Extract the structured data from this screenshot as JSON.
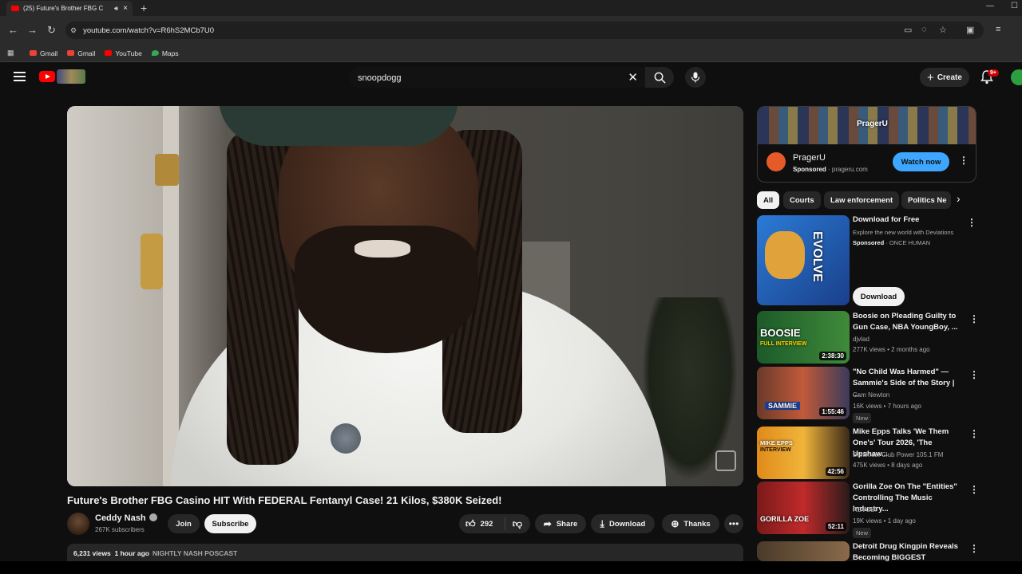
{
  "browser": {
    "tab_title": "(25) Future's Brother FBG C",
    "url": "youtube.com/watch?v=R6hS2MCb7U0",
    "bookmarks": [
      "Gmail",
      "Gmail",
      "YouTube",
      "Maps"
    ]
  },
  "header": {
    "search_value": "snoopdogg",
    "create_label": "Create",
    "notification_count": "9+"
  },
  "video": {
    "title": "Future's Brother FBG Casino HIT With FEDERAL Fentanyl Case! 21 Kilos, $380K Seized!",
    "channel": "Ceddy Nash",
    "subscribers": "267K subscribers",
    "join_label": "Join",
    "subscribe_label": "Subscribe",
    "likes": "292",
    "share_label": "Share",
    "download_label": "Download",
    "thanks_label": "Thanks",
    "views": "6,231 views",
    "posted": "1 hour ago",
    "tag": "NIGHTLY NASH POSCAST"
  },
  "ad": {
    "banner_brand": "PragerU",
    "name": "PragerU",
    "sponsored": "Sponsored",
    "domain": "prageru.com",
    "watch_label": "Watch now"
  },
  "chips": [
    "All",
    "Courts",
    "Law enforcement",
    "Politics Ne"
  ],
  "sponsored_game": {
    "title": "Download for Free",
    "description": "Explore the new world with Deviations",
    "sponsored": "Sponsored",
    "advertiser": "ONCE HUMAN",
    "thumb_text": "EVOLVE",
    "download_label": "Download"
  },
  "recommendations": [
    {
      "title": "Boosie on Pleading Guilty to Gun Case, NBA YoungBoy, ...",
      "channel": "djvlad",
      "meta": "277K views • 2 months ago",
      "duration": "2:38:30",
      "thumb_text": "BOOSIE",
      "thumb_sub": "FULL INTERVIEW",
      "new": ""
    },
    {
      "title": "\"No Child Was Harmed\" — Sammie's Side of the Story | ...",
      "channel": "Cam Newton",
      "meta": "16K views • 7 hours ago",
      "duration": "1:55:46",
      "thumb_text": "SAMMIE",
      "thumb_sub": "",
      "new": "New"
    },
    {
      "title": "Mike Epps Talks 'We Them One's' Tour 2026, 'The Upshaw...",
      "channel": "Breakfast Club Power 105.1 FM",
      "meta": "475K views • 8 days ago",
      "duration": "42:56",
      "thumb_text": "MIKE EPPS",
      "thumb_sub": "INTERVIEW",
      "new": ""
    },
    {
      "title": "Gorilla Zoe On The \"Entities\" Controlling The Music Industry...",
      "channel": "REVOLT",
      "meta": "19K views • 1 day ago",
      "duration": "52:11",
      "thumb_text": "GORILLA ZOE",
      "thumb_sub": "",
      "new": "New"
    },
    {
      "title": "Detroit Drug Kingpin Reveals Becoming BIGGEST Distributo...",
      "channel": "",
      "meta": "",
      "duration": "",
      "thumb_text": "",
      "thumb_sub": "",
      "new": ""
    }
  ]
}
